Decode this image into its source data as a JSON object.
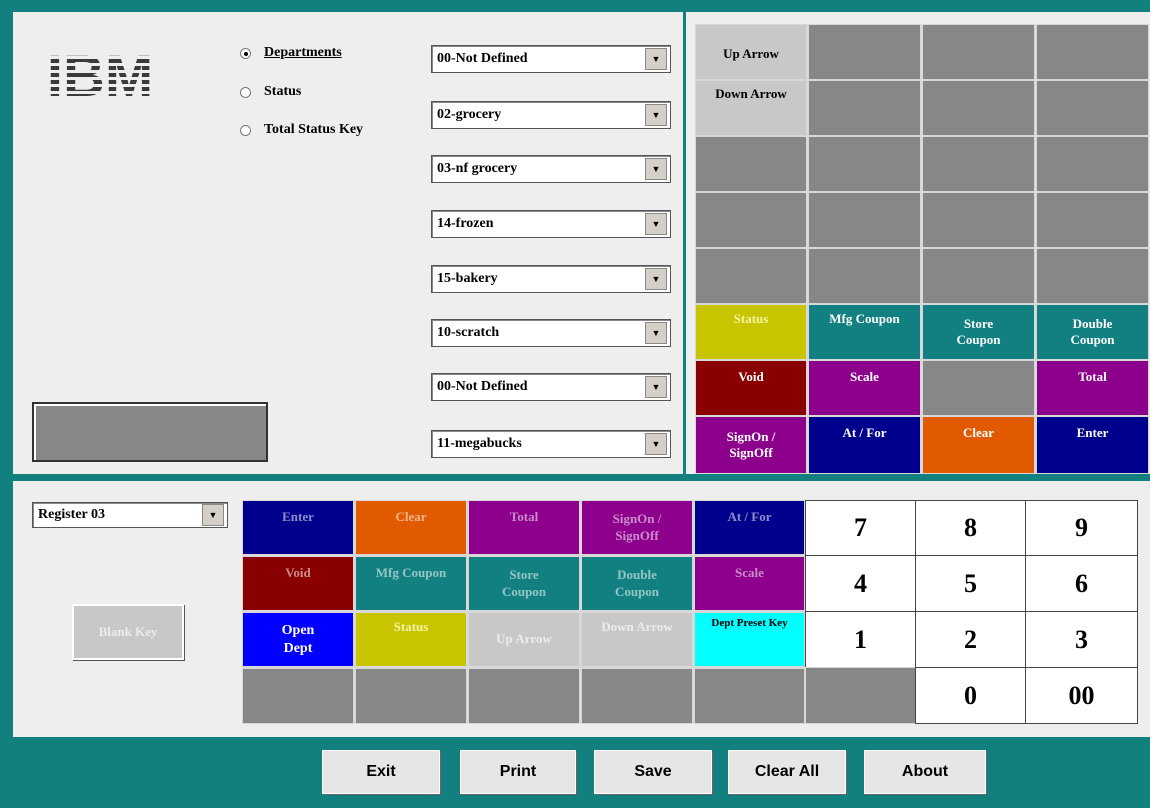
{
  "logo_text": "IBM",
  "modes": [
    {
      "label": "Departments",
      "selected": true
    },
    {
      "label": "Status",
      "selected": false
    },
    {
      "label": "Total Status Key",
      "selected": false
    }
  ],
  "dept_selects": [
    "00-Not Defined",
    "02-grocery",
    "03-nf grocery",
    "14-frozen",
    "15-bakery",
    "10-scratch",
    "00-Not Defined",
    "11-megabucks"
  ],
  "register_select": "Register 03",
  "blank_key": "Blank Key",
  "top_keys": [
    [
      "Up Arrow",
      "",
      "",
      ""
    ],
    [
      "Down Arrow",
      "",
      "",
      ""
    ],
    [
      "",
      "",
      "",
      ""
    ],
    [
      "",
      "",
      "",
      ""
    ],
    [
      "",
      "",
      "",
      ""
    ],
    [
      "Status",
      "Mfg Coupon",
      "Store Coupon",
      "Double Coupon"
    ],
    [
      "Void",
      "Scale",
      "",
      "Total"
    ],
    [
      "SignOn / SignOff",
      "At / For",
      "Clear",
      "Enter"
    ]
  ],
  "bottom_keys": [
    [
      "Enter",
      "Clear",
      "Total",
      "SignOn / SignOff",
      "At / For"
    ],
    [
      "Void",
      "Mfg Coupon",
      "Store Coupon",
      "Double Coupon",
      "Scale"
    ],
    [
      "Open Dept",
      "Status",
      "Up Arrow",
      "Down Arrow",
      "Dept Preset Key"
    ],
    [
      "",
      "",
      "",
      "",
      ""
    ]
  ],
  "numpad": [
    [
      "7",
      "8",
      "9"
    ],
    [
      "4",
      "5",
      "6"
    ],
    [
      "1",
      "2",
      "3"
    ],
    [
      "",
      "0",
      "00"
    ]
  ],
  "buttons": [
    "Exit",
    "Print",
    "Save",
    "Clear All",
    "About"
  ],
  "colors": {
    "frame": "#138080",
    "grey": "#878787",
    "teal": "#128080",
    "olive": "#c9c400",
    "maroon": "#8a0000",
    "purple": "#8c008c",
    "navy": "#00008c",
    "orange": "#e25a00",
    "blue": "#0000ff",
    "cyan": "#00ffff",
    "silver": "#c8c8c8"
  }
}
